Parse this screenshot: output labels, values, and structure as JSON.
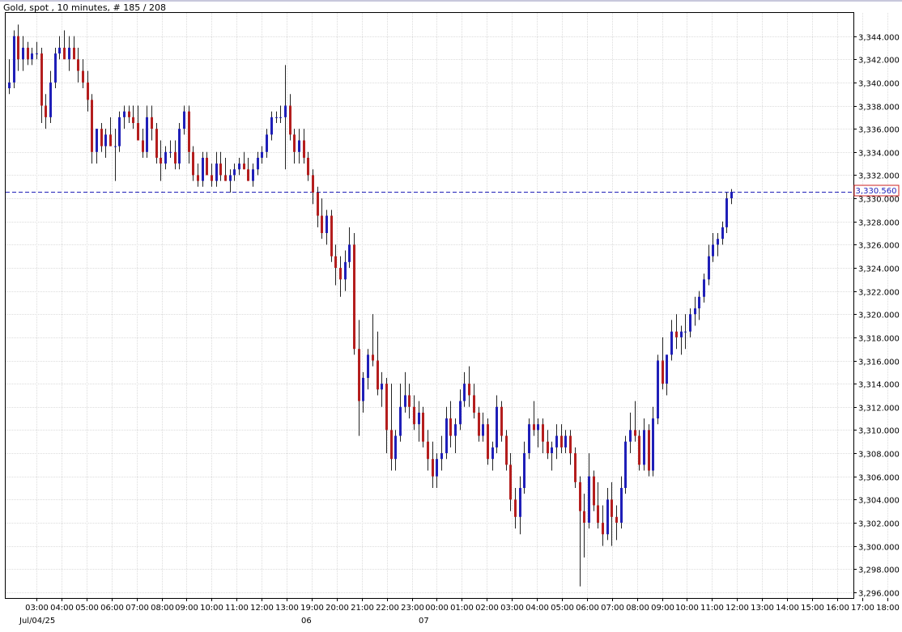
{
  "header": {
    "title": "Gold, spot , 10 minutes, # 185 / 208"
  },
  "colors": {
    "bull": "#1f1fb8",
    "bear": "#b41e1e",
    "wick": "#222222",
    "grid": "#dcdcdc",
    "price_line": "#1f1fb8",
    "price_box_border": "#cc2222",
    "price_box_text": "#1f1fb8",
    "frame": "#000000",
    "title_bar": "#d8d8e8"
  },
  "chart_data": {
    "type": "candlestick",
    "ylim": [
      3295.5,
      3346
    ],
    "y_ticks": [
      "3,344.000",
      "3,342.000",
      "3,340.000",
      "3,338.000",
      "3,336.000",
      "3,334.000",
      "3,332.000",
      "3,330.000",
      "3,328.000",
      "3,326.000",
      "3,324.000",
      "3,322.000",
      "3,320.000",
      "3,318.000",
      "3,316.000",
      "3,314.000",
      "3,312.000",
      "3,310.000",
      "3,308.000",
      "3,306.000",
      "3,304.000",
      "3,302.000",
      "3,300.000",
      "3,298.000",
      "3,296.000"
    ],
    "x_ticks": [
      "03:00",
      "04:00",
      "05:00",
      "06:00",
      "07:00",
      "08:00",
      "09:00",
      "10:00",
      "11:00",
      "12:00",
      "13:00",
      "19:00",
      "20:00",
      "21:00",
      "22:00",
      "23:00",
      "00:00",
      "01:00",
      "02:00",
      "03:00",
      "04:00",
      "05:00",
      "06:00",
      "07:00",
      "08:00",
      "09:00",
      "10:00",
      "11:00",
      "12:00",
      "13:00",
      "14:00",
      "15:00",
      "16:00",
      "17:00",
      "18:00"
    ],
    "date_labels": [
      "Jul/04/25",
      "06",
      "07"
    ],
    "last_price": 3330.56,
    "last_price_label": "3,330.560",
    "candles": [
      [
        3339.5,
        3342,
        3339,
        3340
      ],
      [
        3340,
        3344.5,
        3339.5,
        3344
      ],
      [
        3344,
        3345,
        3341,
        3342
      ],
      [
        3342,
        3344,
        3341,
        3343
      ],
      [
        3343,
        3343.5,
        3341.5,
        3342
      ],
      [
        3342,
        3343,
        3341.5,
        3342.5
      ],
      [
        3342.5,
        3343.5,
        3342,
        3342.5
      ],
      [
        3342.5,
        3343,
        3336.5,
        3338
      ],
      [
        3338,
        3339,
        3336,
        3337
      ],
      [
        3337,
        3341,
        3336.5,
        3340
      ],
      [
        3340,
        3343,
        3339.5,
        3342.5
      ],
      [
        3342.5,
        3344,
        3342,
        3343
      ],
      [
        3343,
        3344.5,
        3342.5,
        3342
      ],
      [
        3342,
        3344,
        3341,
        3343
      ],
      [
        3343,
        3344,
        3342.5,
        3342
      ],
      [
        3342,
        3343,
        3340,
        3341
      ],
      [
        3341,
        3342,
        3339.5,
        3340
      ],
      [
        3340,
        3341,
        3337.5,
        3338.5
      ],
      [
        3338.5,
        3339,
        3333,
        3334
      ],
      [
        3334,
        3336,
        3333,
        3336
      ],
      [
        3336,
        3336.5,
        3334,
        3334.5
      ],
      [
        3334.5,
        3336,
        3333.5,
        3335.5
      ],
      [
        3335.5,
        3337,
        3334.5,
        3334.5
      ],
      [
        3334.5,
        3336,
        3331.5,
        3334.5
      ],
      [
        3334.5,
        3337.5,
        3334,
        3337
      ],
      [
        3337,
        3338,
        3336,
        3337.5
      ],
      [
        3337.5,
        3338,
        3336.5,
        3337
      ],
      [
        3337,
        3338,
        3336,
        3336.5
      ],
      [
        3336.5,
        3338,
        3335.5,
        3335
      ],
      [
        3335,
        3336,
        3333.5,
        3334
      ],
      [
        3334,
        3338,
        3333.5,
        3337
      ],
      [
        3337,
        3338,
        3335,
        3336
      ],
      [
        3336,
        3336.5,
        3333,
        3333.5
      ],
      [
        3333.5,
        3335,
        3331.5,
        3333
      ],
      [
        3333,
        3334.5,
        3332.5,
        3334
      ],
      [
        3334,
        3335,
        3333.5,
        3334
      ],
      [
        3334,
        3335,
        3332.5,
        3333
      ],
      [
        3333,
        3336.5,
        3332.5,
        3336
      ],
      [
        3336,
        3338,
        3335.5,
        3337.5
      ],
      [
        3337.5,
        3338,
        3333,
        3334
      ],
      [
        3334,
        3334.5,
        3331.5,
        3332
      ],
      [
        3332,
        3333,
        3331,
        3331.5
      ],
      [
        3331.5,
        3334,
        3331,
        3333.5
      ],
      [
        3333.5,
        3334,
        3332.5,
        3332
      ],
      [
        3332,
        3333,
        3331,
        3331.5
      ],
      [
        3331.5,
        3334,
        3331,
        3333
      ],
      [
        3333,
        3334,
        3331.5,
        3332
      ],
      [
        3332,
        3333.5,
        3331.5,
        3331.5
      ],
      [
        3331.5,
        3332.5,
        3330.5,
        3332
      ],
      [
        3332,
        3333,
        3331.5,
        3332.5
      ],
      [
        3332.5,
        3333.5,
        3332,
        3333
      ],
      [
        3333,
        3334,
        3332.5,
        3332.5
      ],
      [
        3332.5,
        3333.5,
        3331.5,
        3331.5
      ],
      [
        3331.5,
        3333,
        3331,
        3332.5
      ],
      [
        3332.5,
        3334,
        3332,
        3333.5
      ],
      [
        3333.5,
        3334.5,
        3333,
        3334
      ],
      [
        3334,
        3336,
        3333.5,
        3335.5
      ],
      [
        3335.5,
        3337.5,
        3335,
        3337
      ],
      [
        3337,
        3337.5,
        3336.5,
        3337
      ],
      [
        3337,
        3338,
        3336.5,
        3337
      ],
      [
        3337,
        3341.5,
        3332.5,
        3338
      ],
      [
        3338,
        3339,
        3335,
        3335.5
      ],
      [
        3335.5,
        3336,
        3333,
        3334
      ],
      [
        3334,
        3336,
        3333,
        3335
      ],
      [
        3335,
        3336,
        3333,
        3333.5
      ],
      [
        3333.5,
        3334,
        3331.5,
        3332
      ],
      [
        3332,
        3332.5,
        3329.5,
        3330.5
      ],
      [
        3330.5,
        3331,
        3327.5,
        3328.5
      ],
      [
        3328.5,
        3330,
        3326.5,
        3327
      ],
      [
        3327,
        3329,
        3326,
        3328.5
      ],
      [
        3328.5,
        3329,
        3324.5,
        3325
      ],
      [
        3325,
        3326,
        3322.5,
        3324
      ],
      [
        3324,
        3325,
        3321.5,
        3323
      ],
      [
        3323,
        3325.5,
        3322,
        3324.5
      ],
      [
        3324.5,
        3327.5,
        3324,
        3326
      ],
      [
        3326,
        3327,
        3316.5,
        3317
      ],
      [
        3317,
        3319.5,
        3309.5,
        3312.5
      ],
      [
        3312.5,
        3315,
        3311.5,
        3314.5
      ],
      [
        3314.5,
        3317,
        3313.5,
        3316.5
      ],
      [
        3316.5,
        3320,
        3315.5,
        3316
      ],
      [
        3316,
        3318.5,
        3313,
        3313.5
      ],
      [
        3313.5,
        3315,
        3312,
        3314
      ],
      [
        3314,
        3314.5,
        3308,
        3310
      ],
      [
        3310,
        3314,
        3306.5,
        3307.5
      ],
      [
        3307.5,
        3310,
        3306.5,
        3309.5
      ],
      [
        3309.5,
        3314,
        3309,
        3312
      ],
      [
        3312,
        3315,
        3311.5,
        3313
      ],
      [
        3313,
        3314,
        3311,
        3312
      ],
      [
        3312,
        3313,
        3310,
        3310.5
      ],
      [
        3310.5,
        3312.5,
        3309,
        3311.5
      ],
      [
        3311.5,
        3312,
        3308.5,
        3309
      ],
      [
        3309,
        3310,
        3306.5,
        3307.5
      ],
      [
        3307.5,
        3309,
        3305,
        3306
      ],
      [
        3306,
        3308,
        3305,
        3307.5
      ],
      [
        3307.5,
        3309.5,
        3306.5,
        3308
      ],
      [
        3308,
        3312,
        3307.5,
        3311
      ],
      [
        3311,
        3312.5,
        3308.5,
        3309.5
      ],
      [
        3309.5,
        3311,
        3308,
        3310.5
      ],
      [
        3310.5,
        3313.5,
        3310,
        3312.5
      ],
      [
        3312.5,
        3315,
        3312,
        3314
      ],
      [
        3314,
        3315.5,
        3312,
        3313
      ],
      [
        3313,
        3314,
        3311,
        3311.5
      ],
      [
        3311.5,
        3312,
        3309,
        3309.5
      ],
      [
        3309.5,
        3311.5,
        3309,
        3310.5
      ],
      [
        3310.5,
        3311,
        3307,
        3307.5
      ],
      [
        3307.5,
        3309,
        3306.5,
        3308.5
      ],
      [
        3308.5,
        3313,
        3308,
        3312
      ],
      [
        3312,
        3312.5,
        3309,
        3309.5
      ],
      [
        3309.5,
        3310,
        3306.5,
        3307
      ],
      [
        3307,
        3308,
        3303,
        3304
      ],
      [
        3304,
        3305,
        3301.5,
        3302.5
      ],
      [
        3302.5,
        3306,
        3301,
        3305
      ],
      [
        3305,
        3309,
        3304.5,
        3308
      ],
      [
        3308,
        3311,
        3307.5,
        3310.5
      ],
      [
        3310.5,
        3312.5,
        3309.5,
        3310
      ],
      [
        3310,
        3311,
        3308.5,
        3310.5
      ],
      [
        3310.5,
        3311,
        3308,
        3309
      ],
      [
        3309,
        3310,
        3307.5,
        3308
      ],
      [
        3308,
        3309,
        3306.5,
        3308.5
      ],
      [
        3308.5,
        3310.5,
        3307.5,
        3309.5
      ],
      [
        3309.5,
        3310.5,
        3308,
        3308.5
      ],
      [
        3308.5,
        3310,
        3308,
        3309.5
      ],
      [
        3309.5,
        3310,
        3307,
        3308
      ],
      [
        3308,
        3308.5,
        3305,
        3305.5
      ],
      [
        3305.5,
        3306,
        3296.5,
        3303
      ],
      [
        3303,
        3304.5,
        3299,
        3302
      ],
      [
        3302,
        3308,
        3301.5,
        3306
      ],
      [
        3306,
        3306.5,
        3303,
        3303.5
      ],
      [
        3303.5,
        3305.5,
        3301.5,
        3302
      ],
      [
        3302,
        3303.5,
        3300,
        3301
      ],
      [
        3301,
        3305,
        3300.5,
        3304
      ],
      [
        3304,
        3305.5,
        3300,
        3302.5
      ],
      [
        3302.5,
        3303.5,
        3300.5,
        3302
      ],
      [
        3302,
        3306,
        3301.5,
        3305
      ],
      [
        3305,
        3309.5,
        3304.5,
        3309
      ],
      [
        3309,
        3311.5,
        3308,
        3310
      ],
      [
        3310,
        3312.5,
        3309,
        3309.5
      ],
      [
        3309.5,
        3310,
        3306.5,
        3307
      ],
      [
        3307,
        3311,
        3306.5,
        3310
      ],
      [
        3310,
        3310.5,
        3306,
        3306.5
      ],
      [
        3306.5,
        3312,
        3306,
        3311
      ],
      [
        3311,
        3316.5,
        3310.5,
        3316
      ],
      [
        3316,
        3318,
        3313.5,
        3314
      ],
      [
        3314,
        3316.5,
        3313,
        3316.5
      ],
      [
        3316.5,
        3319.5,
        3316,
        3318.5
      ],
      [
        3318.5,
        3320,
        3317,
        3318
      ],
      [
        3318,
        3319,
        3316.5,
        3318.5
      ],
      [
        3318.5,
        3320,
        3317,
        3318.5
      ],
      [
        3318.5,
        3320.5,
        3318,
        3320
      ],
      [
        3320,
        3321.5,
        3319,
        3320.5
      ],
      [
        3320.5,
        3322,
        3319.5,
        3321.5
      ],
      [
        3321.5,
        3323.5,
        3321,
        3323
      ],
      [
        3323,
        3326,
        3322.5,
        3325
      ],
      [
        3325,
        3327,
        3324.5,
        3326
      ],
      [
        3326,
        3327,
        3325,
        3326.5
      ],
      [
        3326.5,
        3328,
        3326,
        3327.5
      ],
      [
        3327.5,
        3330.5,
        3327,
        3330
      ],
      [
        3330,
        3330.8,
        3329.5,
        3330.56
      ]
    ]
  }
}
